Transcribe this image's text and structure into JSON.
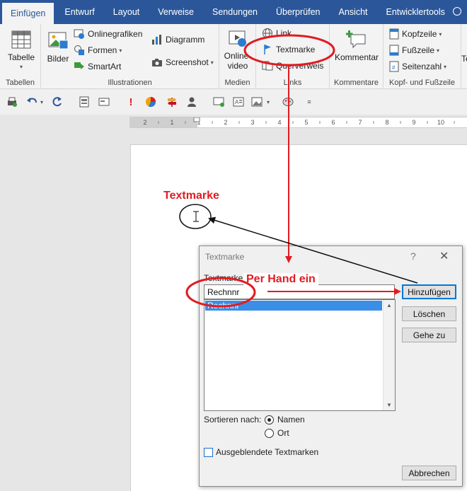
{
  "tabs": [
    {
      "label": "Einfügen",
      "active": true
    },
    {
      "label": "Entwurf"
    },
    {
      "label": "Layout"
    },
    {
      "label": "Verweise"
    },
    {
      "label": "Sendungen"
    },
    {
      "label": "Überprüfen"
    },
    {
      "label": "Ansicht"
    },
    {
      "label": "Entwicklertools"
    }
  ],
  "ribbon": {
    "tabellen": {
      "button": "Tabelle",
      "group": "Tabellen"
    },
    "illustrationen": {
      "bilder": "Bilder",
      "onlinegrafiken": "Onlinegrafiken",
      "formen": "Formen",
      "smartart": "SmartArt",
      "diagramm": "Diagramm",
      "screenshot": "Screenshot",
      "group": "Illustrationen"
    },
    "medien": {
      "button_line1": "Online-",
      "button_line2": "video",
      "group": "Medien"
    },
    "links": {
      "link": "Link",
      "textmarke": "Textmarke",
      "querverweis": "Querverweis",
      "group": "Links"
    },
    "kommentare": {
      "button": "Kommentar",
      "group": "Kommentare"
    },
    "kopf": {
      "kopfzeile": "Kopfzeile",
      "fusszeile": "Fußzeile",
      "seitenzahl": "Seitenzahl",
      "group": "Kopf- und Fußzeile"
    },
    "next_cut": "Te"
  },
  "ruler": {
    "marks": [
      "2",
      "1",
      "1",
      "2",
      "3",
      "4",
      "5",
      "6",
      "7",
      "8",
      "9",
      "10",
      "11"
    ]
  },
  "annotations": {
    "textmarke": "Textmarke",
    "per_hand": "Per Hand ein"
  },
  "dialog": {
    "title": "Textmarke",
    "help": "?",
    "close": "✕",
    "name_label": "Textmarkenname:",
    "name_value": "Rechnnr",
    "list_items": [
      "Rechnnr"
    ],
    "buttons": {
      "add": "Hinzufügen",
      "delete": "Löschen",
      "goto": "Gehe zu",
      "cancel": "Abbrechen"
    },
    "sort_label": "Sortieren nach:",
    "sort_options": {
      "name": "Namen",
      "place": "Ort"
    },
    "sort_selected": "Namen",
    "hidden_label": "Ausgeblendete Textmarken"
  },
  "colors": {
    "ribbon_blue": "#2b579a",
    "annotation_red": "#e11b22",
    "selection_blue": "#3a8ee6"
  }
}
